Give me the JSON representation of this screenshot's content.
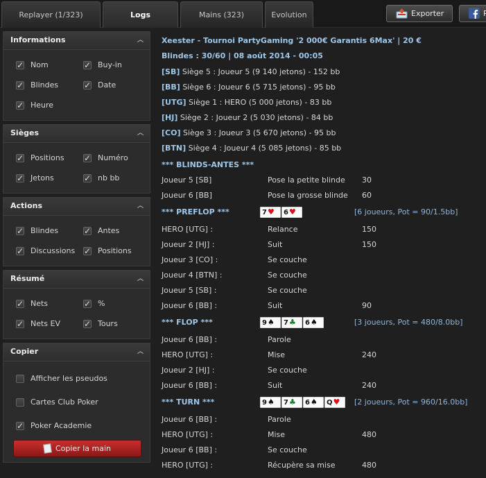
{
  "tabs": [
    {
      "label": "Replayer (1/323)"
    },
    {
      "label": "Logs"
    },
    {
      "label": "Mains (323)"
    },
    {
      "label": "Evolution"
    }
  ],
  "header": {
    "export_label": "Exporter",
    "facebook_label": "P"
  },
  "sidebar": {
    "sections": [
      {
        "title": "Informations",
        "options": [
          {
            "label": "Nom",
            "checked": true
          },
          {
            "label": "Buy-in",
            "checked": true
          },
          {
            "label": "Blindes",
            "checked": true
          },
          {
            "label": "Date",
            "checked": true
          },
          {
            "label": "Heure",
            "checked": true
          }
        ]
      },
      {
        "title": "Sièges",
        "options": [
          {
            "label": "Positions",
            "checked": true
          },
          {
            "label": "Numéro",
            "checked": true
          },
          {
            "label": "Jetons",
            "checked": true
          },
          {
            "label": "nb bb",
            "checked": true
          }
        ]
      },
      {
        "title": "Actions",
        "options": [
          {
            "label": "Blindes",
            "checked": true
          },
          {
            "label": "Antes",
            "checked": true
          },
          {
            "label": "Discussions",
            "checked": true
          },
          {
            "label": "Positions",
            "checked": true
          }
        ]
      },
      {
        "title": "Résumé",
        "options": [
          {
            "label": "Nets",
            "checked": true
          },
          {
            "label": "%",
            "checked": true
          },
          {
            "label": "Nets EV",
            "checked": true
          },
          {
            "label": "Tours",
            "checked": true
          }
        ]
      },
      {
        "title": "Copier",
        "options": [
          {
            "label": "Afficher les pseudos",
            "checked": false
          },
          {
            "label": "Cartes Club Poker",
            "checked": false
          },
          {
            "label": "Poker Academie",
            "checked": true
          }
        ]
      }
    ],
    "copy_button": "Copier la main"
  },
  "log": {
    "header_line1": "Xeester - Tournoi PartyGaming '2 000€ Garantis 6Max' | 20 €",
    "header_line2": "Blindes : 30/60 | 08 août 2014 - 00:05",
    "seats": [
      {
        "pos": "[SB]",
        "text": " Siège 5 : Joueur 5 (9 140 jetons) - 152 bb"
      },
      {
        "pos": "[BB]",
        "text": " Siège 6 : Joueur 6 (5 715 jetons) - 95 bb"
      },
      {
        "pos": "[UTG]",
        "text": " Siège 1 : HERO (5 000 jetons) - 83 bb"
      },
      {
        "pos": "[HJ]",
        "text": " Siège 2 : Joueur 2 (5 030 jetons) - 84 bb"
      },
      {
        "pos": "[CO]",
        "text": " Siège 3 : Joueur 3 (5 670 jetons) - 95 bb"
      },
      {
        "pos": "[BTN]",
        "text": " Siège 4 : Joueur 4 (5 085 jetons) - 85 bb"
      }
    ],
    "blinds_title": "*** BLINDS-ANTES ***",
    "blinds": [
      {
        "player": "Joueur 5 [SB]",
        "action": "Pose la petite blinde",
        "amount": "30"
      },
      {
        "player": "Joueur 6 [BB]",
        "action": "Pose la grosse blinde",
        "amount": "60"
      }
    ],
    "streets": [
      {
        "title": "*** PREFLOP ***",
        "info": "[6 joueurs, Pot = 90/1.5bb]",
        "cards": [
          {
            "rank": "7",
            "suit": "♥",
            "color": "red"
          },
          {
            "rank": "6",
            "suit": "♥",
            "color": "red"
          }
        ],
        "actions": [
          {
            "player": "HERO [UTG] :",
            "action": "Relance",
            "amount": "150"
          },
          {
            "player": "Joueur 2 [HJ] :",
            "action": "Suit",
            "amount": "150"
          },
          {
            "player": "Joueur 3 [CO] :",
            "action": "Se couche",
            "amount": ""
          },
          {
            "player": "Joueur 4 [BTN] :",
            "action": "Se couche",
            "amount": ""
          },
          {
            "player": "Joueur 5 [SB] :",
            "action": "Se couche",
            "amount": ""
          },
          {
            "player": "Joueur 6 [BB] :",
            "action": "Suit",
            "amount": "90"
          }
        ]
      },
      {
        "title": "*** FLOP ***",
        "info": "[3 joueurs, Pot = 480/8.0bb]",
        "cards": [
          {
            "rank": "9",
            "suit": "♠",
            "color": "black"
          },
          {
            "rank": "7",
            "suit": "♣",
            "color": "green"
          },
          {
            "rank": "6",
            "suit": "♠",
            "color": "black"
          }
        ],
        "actions": [
          {
            "player": "Joueur 6 [BB] :",
            "action": "Parole",
            "amount": ""
          },
          {
            "player": "HERO [UTG] :",
            "action": "Mise",
            "amount": "240"
          },
          {
            "player": "Joueur 2 [HJ] :",
            "action": "Se couche",
            "amount": ""
          },
          {
            "player": "Joueur 6 [BB] :",
            "action": "Suit",
            "amount": "240"
          }
        ]
      },
      {
        "title": "*** TURN ***",
        "info": "[2 joueurs, Pot = 960/16.0bb]",
        "cards": [
          {
            "rank": "9",
            "suit": "♠",
            "color": "black"
          },
          {
            "rank": "7",
            "suit": "♣",
            "color": "green"
          },
          {
            "rank": "6",
            "suit": "♠",
            "color": "black"
          },
          {
            "rank": "Q",
            "suit": "♥",
            "color": "red"
          }
        ],
        "actions": [
          {
            "player": "Joueur 6 [BB] :",
            "action": "Parole",
            "amount": ""
          },
          {
            "player": "HERO [UTG] :",
            "action": "Mise",
            "amount": "480"
          },
          {
            "player": "Joueur 6 [BB] :",
            "action": "Se couche",
            "amount": ""
          },
          {
            "player": "HERO [UTG] :",
            "action": "Récupère sa mise",
            "amount": "480"
          }
        ]
      }
    ]
  }
}
